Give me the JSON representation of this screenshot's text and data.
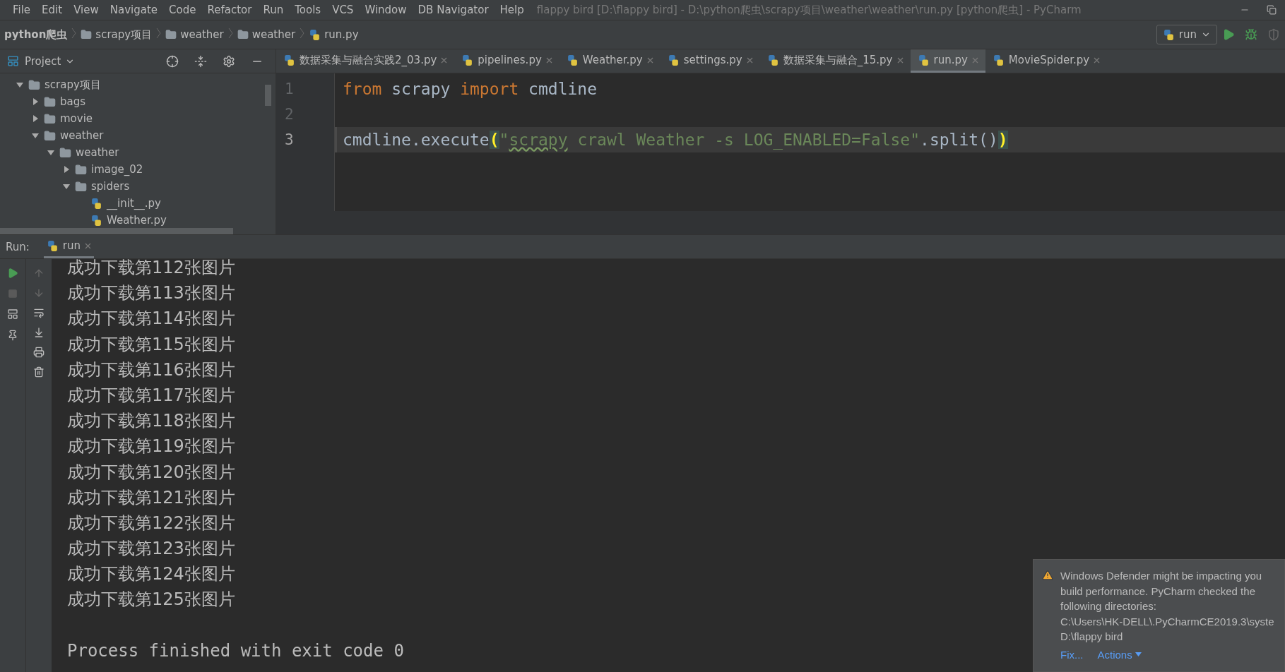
{
  "menu_bar": {
    "items": [
      "File",
      "Edit",
      "View",
      "Navigate",
      "Code",
      "Refactor",
      "Run",
      "Tools",
      "VCS",
      "Window",
      "DB Navigator",
      "Help"
    ],
    "title": "flappy bird [D:\\flappy bird] - D:\\python爬虫\\scrapy项目\\weather\\weather\\run.py [python爬虫] - PyCharm"
  },
  "breadcrumbs": [
    {
      "label": "python爬虫",
      "kind": "project"
    },
    {
      "label": "scrapy项目",
      "kind": "folder"
    },
    {
      "label": "weather",
      "kind": "folder"
    },
    {
      "label": "weather",
      "kind": "folder"
    },
    {
      "label": "run.py",
      "kind": "file"
    }
  ],
  "run_config": {
    "label": "run"
  },
  "project_panel": {
    "title": "Project",
    "tree": [
      {
        "label": "scrapy项目",
        "kind": "folder",
        "expanded": true,
        "children": [
          {
            "label": "bags",
            "kind": "folder",
            "expanded": false
          },
          {
            "label": "movie",
            "kind": "folder",
            "expanded": false
          },
          {
            "label": "weather",
            "kind": "folder",
            "expanded": true,
            "children": [
              {
                "label": "weather",
                "kind": "folder",
                "expanded": true,
                "children": [
                  {
                    "label": "image_02",
                    "kind": "folder",
                    "expanded": false
                  },
                  {
                    "label": "spiders",
                    "kind": "folder",
                    "expanded": true,
                    "children": [
                      {
                        "label": "__init__.py",
                        "kind": "file"
                      },
                      {
                        "label": "Weather.py",
                        "kind": "file"
                      }
                    ]
                  }
                ]
              }
            ]
          }
        ]
      }
    ]
  },
  "editor_tabs": [
    {
      "label": "数据采集与融合实践2_03.py",
      "selected": false
    },
    {
      "label": "pipelines.py",
      "selected": false
    },
    {
      "label": "Weather.py",
      "selected": false
    },
    {
      "label": "settings.py",
      "selected": false
    },
    {
      "label": "数据采集与融合_15.py",
      "selected": false
    },
    {
      "label": "run.py",
      "selected": true
    },
    {
      "label": "MovieSpider.py",
      "selected": false
    }
  ],
  "editor": {
    "lines": [
      {
        "number": "1",
        "current": false,
        "tokens": [
          {
            "text": "from",
            "kind": "keyword"
          },
          {
            "text": " scrapy ",
            "kind": "plain"
          },
          {
            "text": "import",
            "kind": "keyword"
          },
          {
            "text": " cmdline",
            "kind": "plain"
          }
        ]
      },
      {
        "number": "2",
        "current": false
      },
      {
        "number": "3",
        "current": true,
        "tokens": [
          {
            "text": "cmdline.execute",
            "kind": "plain"
          },
          {
            "text": "(",
            "kind": "match"
          },
          {
            "text": "\"",
            "kind": "string"
          },
          {
            "text": "scrapy",
            "kind": "typo"
          },
          {
            "text": " crawl Weather -s LOG_ENABLED=False\"",
            "kind": "string"
          },
          {
            "text": ".split()",
            "kind": "plain"
          },
          {
            "text": ")",
            "kind": "match"
          }
        ]
      }
    ]
  },
  "run_panel": {
    "label": "Run:",
    "tab": "run",
    "output": [
      "成功下载第112张图片",
      "成功下载第113张图片",
      "成功下载第114张图片",
      "成功下载第115张图片",
      "成功下载第116张图片",
      "成功下载第117张图片",
      "成功下载第118张图片",
      "成功下载第119张图片",
      "成功下载第120张图片",
      "成功下载第121张图片",
      "成功下载第122张图片",
      "成功下载第123张图片",
      "成功下载第124张图片",
      "成功下载第125张图片"
    ],
    "exit_message": "Process finished with exit code 0"
  },
  "notification": {
    "lines": [
      "Windows Defender might be impacting you",
      "build performance. PyCharm checked the",
      "following directories:",
      "C:\\Users\\HK-DELL\\.PyCharmCE2019.3\\syste",
      "D:\\flappy bird"
    ],
    "actions": [
      "Fix...",
      "Actions"
    ]
  }
}
